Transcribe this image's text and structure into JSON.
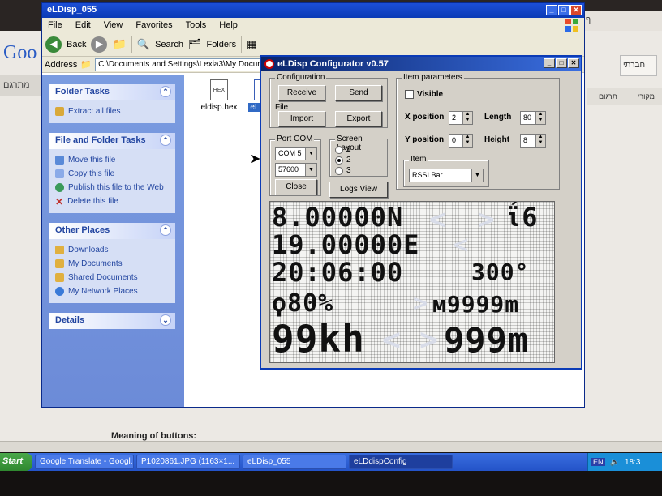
{
  "browser": {
    "tab_text": "ף זה תורגם מ",
    "logo": "Goo",
    "left_strip": "מתרגם",
    "right_box": "חברתי",
    "right_tabs": [
      "תרגום",
      "מקורי"
    ]
  },
  "explorer": {
    "title": "eLDisp_055",
    "menu": [
      "File",
      "Edit",
      "View",
      "Favorites",
      "Tools",
      "Help"
    ],
    "toolbar": {
      "back": "Back",
      "search": "Search",
      "folders": "Folders"
    },
    "address_label": "Address",
    "address_value": "C:\\Documents and Settings\\Lexia3\\My Documents\\De",
    "folder_tasks": {
      "title": "Folder Tasks",
      "items": [
        "Extract all files"
      ]
    },
    "file_tasks": {
      "title": "File and Folder Tasks",
      "items": [
        "Move this file",
        "Copy this file",
        "Publish this file to the Web",
        "Delete this file"
      ]
    },
    "other_places": {
      "title": "Other Places",
      "items": [
        "Downloads",
        "My Documents",
        "Shared Documents",
        "My Network Places"
      ]
    },
    "details": {
      "title": "Details"
    },
    "files": [
      {
        "name": "eldisp.hex",
        "icon_text": "HEX"
      },
      {
        "name": "eLDisp"
      }
    ]
  },
  "config": {
    "title": "eLDisp Configurator v0.57",
    "configuration": {
      "label": "Configuration",
      "receive": "Receive",
      "send": "Send"
    },
    "file": {
      "label": "File",
      "import": "Import",
      "export": "Export"
    },
    "port": {
      "label": "Port COM",
      "com": "COM 5",
      "baud": "57600",
      "close": "Close"
    },
    "screen_layout": {
      "label": "Screen Layout",
      "options": [
        "1",
        "2",
        "3"
      ],
      "selected": "2",
      "logs": "Logs View"
    },
    "item_params": {
      "label": "Item parameters",
      "visible": "Visible",
      "x_label": "X position",
      "x_value": "2",
      "y_label": "Y position",
      "y_value": "0",
      "length_label": "Length",
      "length_value": "80",
      "height_label": "Height",
      "height_value": "8",
      "item_label": "Item",
      "item_value": "RSSI Bar"
    },
    "lcd_lines": [
      "8.00000N",
      "19.00000E",
      "20:06:00",
      "ϙ80%",
      "99kh"
    ],
    "lcd_right": [
      "ΐ6",
      "300°",
      "м9999m",
      "999m"
    ]
  },
  "bottom": {
    "meaning": "Meaning of buttons:"
  },
  "taskbar": {
    "start": "Start",
    "buttons": [
      "Google Translate - Googl...",
      "P1020861.JPG (1163×1...",
      "eLDisp_055",
      "eLDdispConfig"
    ],
    "lang": "EN",
    "clock": "18:3"
  },
  "colors": {
    "xp_blue": "#0b3bb6",
    "task_pane": "#7b9ce0",
    "dialog_gray": "#d4d0c8"
  }
}
